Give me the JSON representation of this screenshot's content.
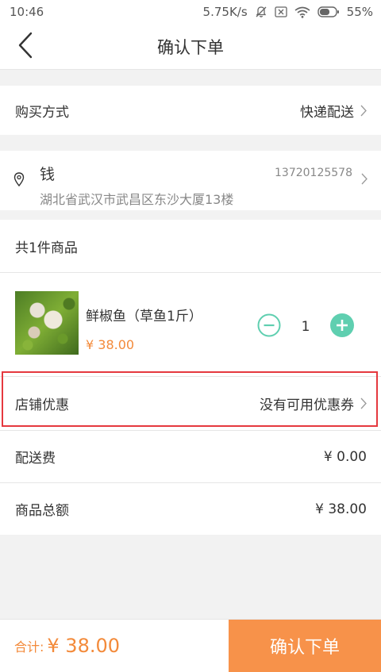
{
  "status_bar": {
    "time": "10:46",
    "network_speed": "5.75K/s",
    "battery": "55%",
    "icons": [
      "bell-off-icon",
      "sim-x-icon",
      "wifi-icon",
      "battery-icon"
    ]
  },
  "header": {
    "title": "确认下单",
    "back_icon": "back-arrow-icon"
  },
  "purchase_method": {
    "label": "购买方式",
    "value": "快递配送"
  },
  "address": {
    "name": "钱",
    "phone": "13720125578",
    "detail": "湖北省武汉市武昌区东沙大厦13楼",
    "icon": "location-pin-icon"
  },
  "items_header": {
    "label": "共1件商品"
  },
  "product": {
    "name": "鲜椒鱼（草鱼1斤）",
    "price": "¥ 38.00",
    "quantity": "1"
  },
  "coupon": {
    "label": "店铺优惠",
    "value": "没有可用优惠券"
  },
  "delivery_fee": {
    "label": "配送费",
    "value": "¥ 0.00"
  },
  "goods_total": {
    "label": "商品总额",
    "value": "¥ 38.00"
  },
  "footer": {
    "total_label": "合计:",
    "total_value": "¥ 38.00",
    "confirm_label": "确认下单"
  },
  "colors": {
    "accent_orange": "#f7924a",
    "price_orange": "#f38a3a",
    "stepper_teal": "#5fcfb0",
    "highlight_red": "#e5393f"
  }
}
